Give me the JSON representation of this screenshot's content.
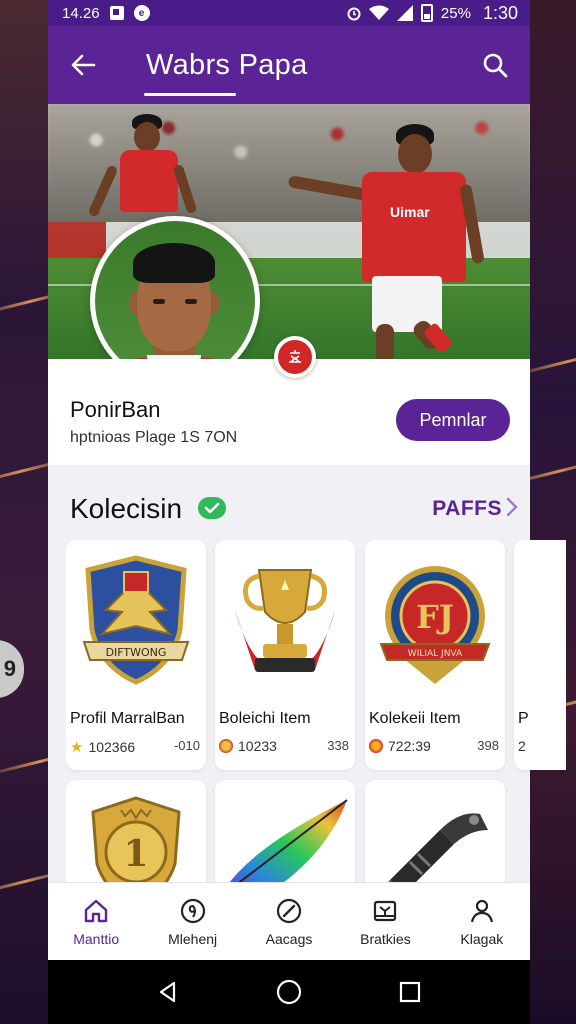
{
  "status_bar": {
    "time_left": "14.26",
    "battery": "25%",
    "time_right": "1:30"
  },
  "app_bar": {
    "title": "Wabrs Papa"
  },
  "hero": {
    "shirt_text": "Uimar"
  },
  "profile": {
    "name": "PonirBan",
    "subtitle": "hptnioas Plage  1S 7ON",
    "action_label": "Pemnlar"
  },
  "collection": {
    "heading": "Kolecisin",
    "more_label": "PAFFS",
    "items": [
      {
        "label": "Profil MarralBan",
        "stat": "102366",
        "extra": "-010",
        "badge_text": "DIFTWONG",
        "icon": "winged-shield-icon"
      },
      {
        "label": "Boleichi Item",
        "stat": "10233",
        "extra": "338",
        "icon": "trophy-icon"
      },
      {
        "label": "Kolekeii Item",
        "stat": "722:39",
        "extra": "398",
        "badge_text": "FJ",
        "badge_caption": "WILIAL JNVA",
        "icon": "crest-badge-icon"
      },
      {
        "label": "P",
        "stat": "2",
        "icon": "partial-item-icon"
      }
    ],
    "row2_items": [
      {
        "badge_text": "1",
        "icon": "gold-medal-icon"
      },
      {
        "icon": "feather-icon"
      },
      {
        "icon": "grip-tool-icon"
      }
    ]
  },
  "bottom_nav": {
    "items": [
      {
        "label": "Manttio",
        "icon": "home-icon",
        "active": true
      },
      {
        "label": "Mlehenj",
        "icon": "spiral-icon",
        "active": false
      },
      {
        "label": "Aacags",
        "icon": "compass-icon",
        "active": false
      },
      {
        "label": "Bratkies",
        "icon": "tray-icon",
        "active": false
      },
      {
        "label": "Klagak",
        "icon": "profile-icon",
        "active": false
      }
    ]
  },
  "side_tab": {
    "label": "9"
  },
  "colors": {
    "primary": "#5a2396",
    "status_bar": "#4a1c8a",
    "verified": "#2fb95a",
    "badge": "#d32626"
  }
}
